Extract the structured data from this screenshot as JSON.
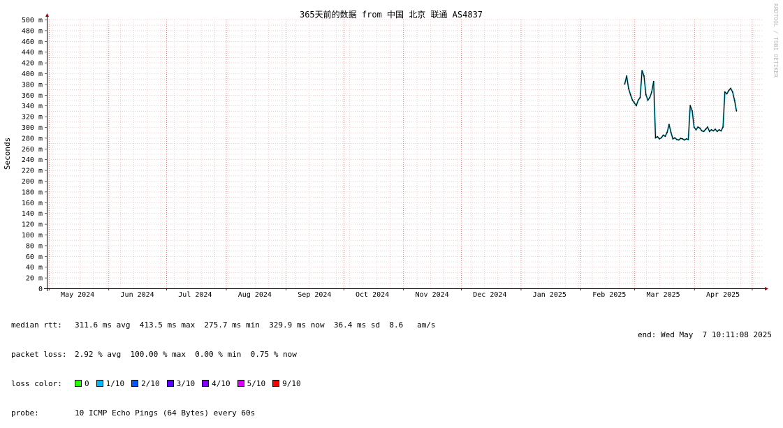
{
  "chart_data": {
    "type": "line",
    "title": "365天前的数据 from 中国 北京 联通 AS4837",
    "ylabel": "Seconds",
    "watermark": "RRDTOOL / TOBI OETIKER",
    "ylim": [
      0,
      500
    ],
    "yticks": [
      "0",
      "20 m",
      "40 m",
      "60 m",
      "80 m",
      "100 m",
      "120 m",
      "140 m",
      "160 m",
      "180 m",
      "200 m",
      "220 m",
      "240 m",
      "260 m",
      "280 m",
      "300 m",
      "320 m",
      "340 m",
      "360 m",
      "380 m",
      "400 m",
      "420 m",
      "440 m",
      "460 m",
      "480 m",
      "500 m"
    ],
    "x_months": [
      {
        "label": "May 2024",
        "day": 16
      },
      {
        "label": "Jun 2024",
        "day": 47
      },
      {
        "label": "Jul 2024",
        "day": 77
      },
      {
        "label": "Aug 2024",
        "day": 108
      },
      {
        "label": "Sep 2024",
        "day": 139
      },
      {
        "label": "Oct 2024",
        "day": 169
      },
      {
        "label": "Nov 2024",
        "day": 200
      },
      {
        "label": "Dec 2024",
        "day": 230
      },
      {
        "label": "Jan 2025",
        "day": 261
      },
      {
        "label": "Feb 2025",
        "day": 292
      },
      {
        "label": "Mar 2025",
        "day": 320
      },
      {
        "label": "Apr 2025",
        "day": 351
      }
    ],
    "x_range_days": [
      0,
      372
    ],
    "major_grid_days": [
      1,
      32,
      62,
      93,
      124,
      154,
      185,
      215,
      246,
      277,
      305,
      336,
      366
    ],
    "series": [
      {
        "values": [
          [
            300,
            380
          ],
          [
            301,
            395
          ],
          [
            302,
            372
          ],
          [
            303,
            360
          ],
          [
            304,
            350
          ],
          [
            305,
            345
          ],
          [
            306,
            340
          ],
          [
            307,
            350
          ],
          [
            308,
            355
          ],
          [
            309,
            405
          ],
          [
            310,
            395
          ],
          [
            311,
            360
          ],
          [
            312,
            350
          ],
          [
            313,
            355
          ],
          [
            314,
            365
          ],
          [
            315,
            385
          ],
          [
            316,
            280
          ],
          [
            317,
            282
          ],
          [
            318,
            278
          ],
          [
            319,
            280
          ],
          [
            320,
            285
          ],
          [
            321,
            283
          ],
          [
            322,
            290
          ],
          [
            323,
            305
          ],
          [
            324,
            290
          ],
          [
            325,
            278
          ],
          [
            326,
            280
          ],
          [
            327,
            277
          ],
          [
            328,
            276
          ],
          [
            329,
            279
          ],
          [
            330,
            278
          ],
          [
            331,
            276
          ],
          [
            332,
            278
          ],
          [
            333,
            277
          ],
          [
            334,
            340
          ],
          [
            335,
            330
          ],
          [
            336,
            300
          ],
          [
            337,
            295
          ],
          [
            338,
            300
          ],
          [
            339,
            298
          ],
          [
            340,
            293
          ],
          [
            341,
            292
          ],
          [
            342,
            296
          ],
          [
            343,
            300
          ],
          [
            344,
            292
          ],
          [
            345,
            295
          ],
          [
            346,
            293
          ],
          [
            347,
            296
          ],
          [
            348,
            292
          ],
          [
            349,
            295
          ],
          [
            350,
            293
          ],
          [
            351,
            300
          ],
          [
            352,
            365
          ],
          [
            353,
            362
          ],
          [
            354,
            368
          ],
          [
            355,
            372
          ],
          [
            356,
            365
          ],
          [
            357,
            350
          ],
          [
            358,
            330
          ]
        ]
      }
    ],
    "legend": {
      "median_rtt_label": "median rtt:",
      "median_rtt_value": "311.6 ms avg  413.5 ms max  275.7 ms min  329.9 ms now  36.4 ms sd  8.6   am/s",
      "packet_loss_label": "packet loss:",
      "packet_loss_value": "2.92 % avg  100.00 % max  0.00 % min  0.75 % now",
      "loss_color_label": "loss color:",
      "loss_colors": [
        {
          "label": "0",
          "color": "#26ff00"
        },
        {
          "label": "1/10",
          "color": "#00b8ff"
        },
        {
          "label": "2/10",
          "color": "#0059ff"
        },
        {
          "label": "3/10",
          "color": "#5e00ff"
        },
        {
          "label": "4/10",
          "color": "#7e00ff"
        },
        {
          "label": "5/10",
          "color": "#dd00ff"
        },
        {
          "label": "9/10",
          "color": "#ff0000"
        }
      ],
      "probe_label": "probe:",
      "probe_value": "10 ICMP Echo Pings (64 Bytes) every 60s",
      "end_text": "end: Wed May  7 10:11:08 2025"
    }
  }
}
